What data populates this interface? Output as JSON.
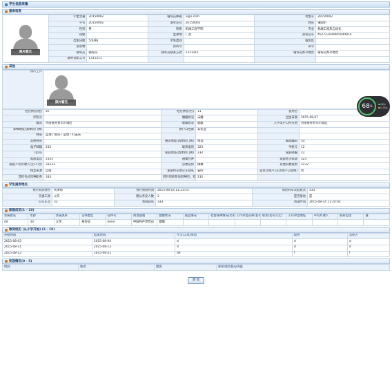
{
  "title": "学生信息采集",
  "sections": {
    "basic": "基本信息",
    "other": "其他",
    "arrival": "学生报到地点",
    "family": "家庭成员(1 - 10)",
    "edu": "教育经历 (从小学开始) (3 - 10)",
    "award": "奖惩情况(0 - 5)"
  },
  "photo_caption": "照片暂无",
  "photo_upload_label": "照片上传",
  "basic_rows": [
    [
      "学生宝箱",
      "20150002",
      "辅导员邮箱",
      "1@1.com",
      "考生号",
      "20150002"
    ],
    [
      "学号",
      "20150002",
      "准考证号",
      "20150002",
      "姓名",
      "谭国珩"
    ],
    [
      "性别",
      "男",
      "院系",
      "机械工程学院",
      "专业",
      "机械工程及自动化"
    ],
    [
      "班级",
      "",
      "生源地",
      "广西",
      "身份证号",
      "452723199605040814"
    ],
    [
      "出生日期",
      "5/4/96",
      "学生类别",
      "",
      "宿舍区",
      ""
    ],
    [
      "宿舍楼",
      "",
      "房间号",
      "",
      "床号",
      ""
    ],
    [
      "辅导员",
      "辅导员",
      "辅导员联系方式",
      "1311211",
      "辅导员办公地点",
      "辅导员办公地点"
    ],
    [
      "辅导员职工号",
      "1311211",
      "",
      "",
      "",
      ""
    ]
  ],
  "other_rows": [
    [
      "姓名拼音(姓)",
      "xx",
      "姓名拼音(名)",
      "11",
      "曾用名",
      ""
    ],
    [
      "护照号",
      "",
      "婚姻状况",
      "未婚",
      "出生日期",
      "2015-08-07"
    ],
    [
      "籍贯",
      "河南省开封市市辖区",
      "健康状况",
      "健康",
      "入学前户口所在地",
      "河南省开封市市辖区"
    ],
    [
      "详细地址(具体到门牌)",
      "",
      "原户口性质",
      "非农业",
      "",
      ""
    ],
    [
      "特长",
      "篮球 / 管乐 / 篮球 / 打击乐",
      "",
      "",
      "",
      ""
    ],
    [
      "其他特长",
      "",
      "通讯地址(具体到门牌)",
      "地址",
      "邮政编码",
      "33"
    ],
    [
      "电子邮箱",
      "232",
      "联系电话",
      "323",
      "手机号",
      "12"
    ],
    [
      "QQ号",
      "",
      "家庭地址(具体到门牌)",
      "232",
      "家庭邮编",
      "22"
    ],
    [
      "家庭电话",
      "2323",
      "通乘合并",
      "",
      "家庭经济来源",
      "323"
    ],
    [
      "家庭人均月收入(元/人月)",
      "33333",
      "宗教信仰",
      "佛教",
      "其他宗教说明",
      "2232"
    ],
    [
      "档案来源",
      "自提",
      "家庭所在地火车站名",
      "安阳",
      "是否迁移户口(迁移户口说明)",
      "否"
    ],
    [
      "曾担任过何种职务",
      "333",
      "何时何地参加何种团、党派",
      "232",
      "",
      ""
    ]
  ],
  "gauge": {
    "value": "68",
    "unit": "%",
    "up": "0K/s",
    "down": "0.1K/s"
  },
  "arrival_rows": [
    [
      "预计到达地点",
      "天津站",
      "预计到校时间",
      "2015-08-14 11:23:53",
      "到达的车次航班次",
      "333"
    ],
    [
      "交通工具",
      "火车",
      "随从亲友人数",
      "2",
      "是否接站",
      "是"
    ],
    [
      "火车车次",
      "33",
      "到站站名",
      "333",
      "到站时间",
      "2015-08-14 11:24:02"
    ]
  ],
  "family_headers": [
    "亲属姓名",
    "年龄",
    "亲属关系",
    "证件类型",
    "证件号",
    "政治面貌",
    "健康状况",
    "就业情况",
    "社会保障情况(若有写无)",
    "工作单位名称(若有写无)",
    "职务(若有写无)",
    "工作单位地址",
    "平均月收入",
    "联系电话",
    "操"
  ],
  "family_rows": [
    [
      "dd",
      "33",
      "父亲",
      "身份证",
      "erere",
      "中国共产党党员",
      "健康",
      "",
      "",
      "",
      "",
      "",
      "",
      "",
      ""
    ]
  ],
  "edu_headers": [
    "开始时间",
    "结束时间",
    "学习(工作)单位",
    "职务",
    "证明人"
  ],
  "edu_rows": [
    [
      "2015-08-03",
      "2015-08-04",
      "d",
      "d",
      "d"
    ],
    [
      "2015-08-11",
      "2015-08-13",
      "d",
      "d",
      "d"
    ],
    [
      "2015-08-13",
      "2015-08-21",
      "dd",
      "f",
      "f"
    ]
  ],
  "award_headers": [
    "时间",
    "地点",
    "原因",
    "获奖/惩罚处分内容"
  ],
  "submit_label": "更 新"
}
